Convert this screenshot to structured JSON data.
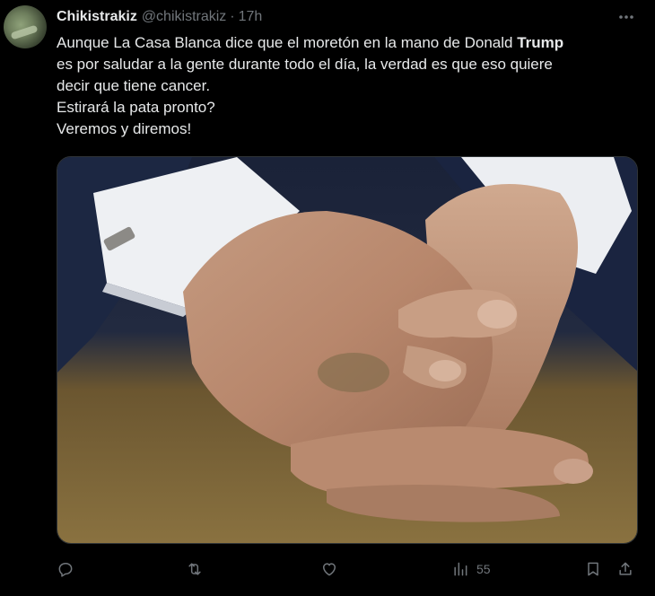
{
  "tweet": {
    "author": {
      "display_name": "Chikistrakiz",
      "handle": "@chikistrakiz",
      "separator": "·",
      "time": "17h"
    },
    "text": {
      "line1_before": "Aunque La Casa Blanca dice que el moretón en la mano de Donald ",
      "line1_bold": "Trump",
      "line2": "es por saludar a la gente durante todo el día, la verdad es que eso quiere",
      "line3": "decir que tiene cancer.",
      "line4": "Estirará la pata pronto?",
      "line5": "Veremos y diremos!"
    },
    "actions": {
      "reply_icon": "reply-icon",
      "retweet_icon": "retweet-icon",
      "like_icon": "heart-icon",
      "views_icon": "views-chart-icon",
      "views_count": "55",
      "bookmark_icon": "bookmark-icon",
      "share_icon": "share-icon"
    }
  },
  "colors": {
    "background": "#000000",
    "text_primary": "#e7e9ea",
    "text_secondary": "#71767b",
    "border": "#2f3336"
  }
}
